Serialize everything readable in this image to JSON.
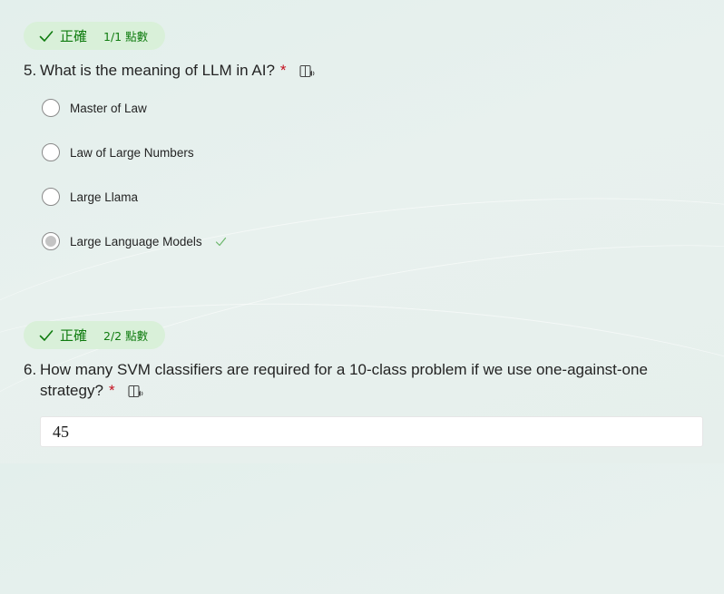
{
  "q5": {
    "badge": {
      "status": "正確",
      "points": "1/1 點數"
    },
    "number": "5.",
    "text": "What is the meaning of LLM in AI?",
    "required_mark": "*",
    "options": [
      {
        "label": "Master of Law",
        "selected": false
      },
      {
        "label": "Law of Large Numbers",
        "selected": false
      },
      {
        "label": "Large Llama",
        "selected": false
      },
      {
        "label": "Large Language Models",
        "selected": true,
        "correct": true
      }
    ]
  },
  "q6": {
    "badge": {
      "status": "正確",
      "points": "2/2 點數"
    },
    "number": "6.",
    "text_line1": "How many SVM classifiers are required for a 10-class problem if we use one-against-one",
    "text_line2": "strategy?",
    "required_mark": "*",
    "answer": "45"
  },
  "colors": {
    "success_green": "#107c10",
    "badge_bg": "#d9f0d9",
    "required_red": "#c50f1f",
    "check_light": "#6bb76b"
  },
  "icons": {
    "status_check": "check-icon",
    "immersive_reader": "immersive-reader-icon",
    "correct_option": "checkmark-icon"
  }
}
